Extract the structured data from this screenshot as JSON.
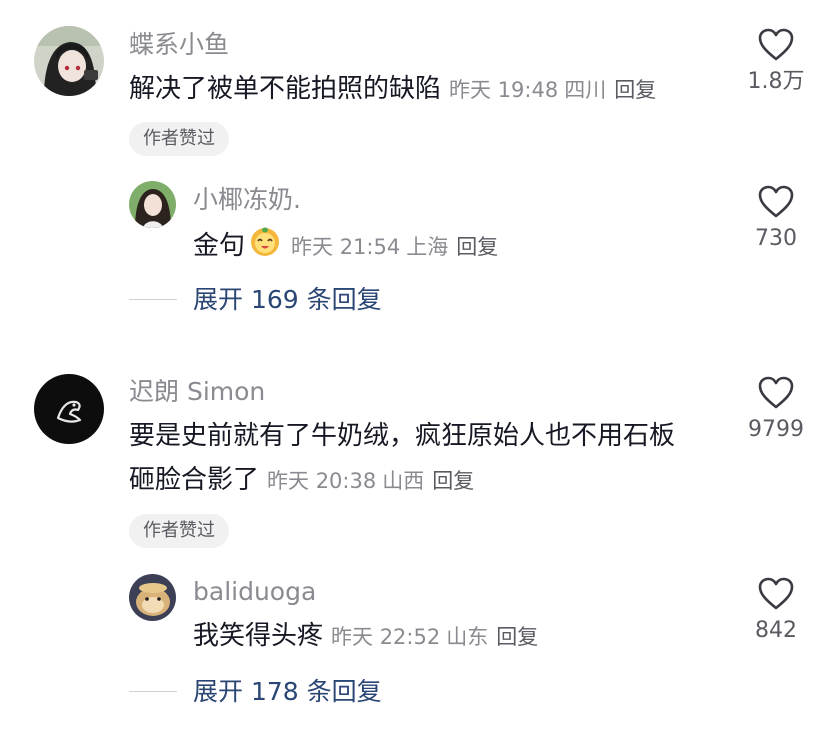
{
  "comments": [
    {
      "username": "蝶系小鱼",
      "text": "解决了被单不能拍照的缺陷",
      "time": "昨天 19:48",
      "location": "四川",
      "reply_label": "回复",
      "likes": "1.8万",
      "badge": "作者赞过",
      "avatar_icon": "anime-girl-avatar",
      "reply": {
        "username": "小椰冻奶.",
        "text": "金句",
        "emoji_icon": "lion-smile-emoji",
        "time": "昨天 21:54",
        "location": "上海",
        "reply_label": "回复",
        "likes": "730",
        "avatar_icon": "girl-photo-avatar"
      },
      "expand_label": "展开 169 条回复"
    },
    {
      "username": "迟朗 Simon",
      "text_line1": "要是史前就有了牛奶绒，疯狂原始人也不用石板",
      "text_line2": "砸脸合影了",
      "time": "昨天 20:38",
      "location": "山西",
      "reply_label": "回复",
      "likes": "9799",
      "badge": "作者赞过",
      "avatar_icon": "black-logo-avatar",
      "reply": {
        "username": "baliduoga",
        "text": "我笑得头疼",
        "time": "昨天 22:52",
        "location": "山东",
        "reply_label": "回复",
        "likes": "842",
        "avatar_icon": "hamster-avatar"
      },
      "expand_label": "展开 178 条回复"
    }
  ],
  "colors": {
    "text": "#161823",
    "muted": "#8a8b91",
    "link": "#2a4674",
    "badge_bg": "#f1f1f2"
  }
}
